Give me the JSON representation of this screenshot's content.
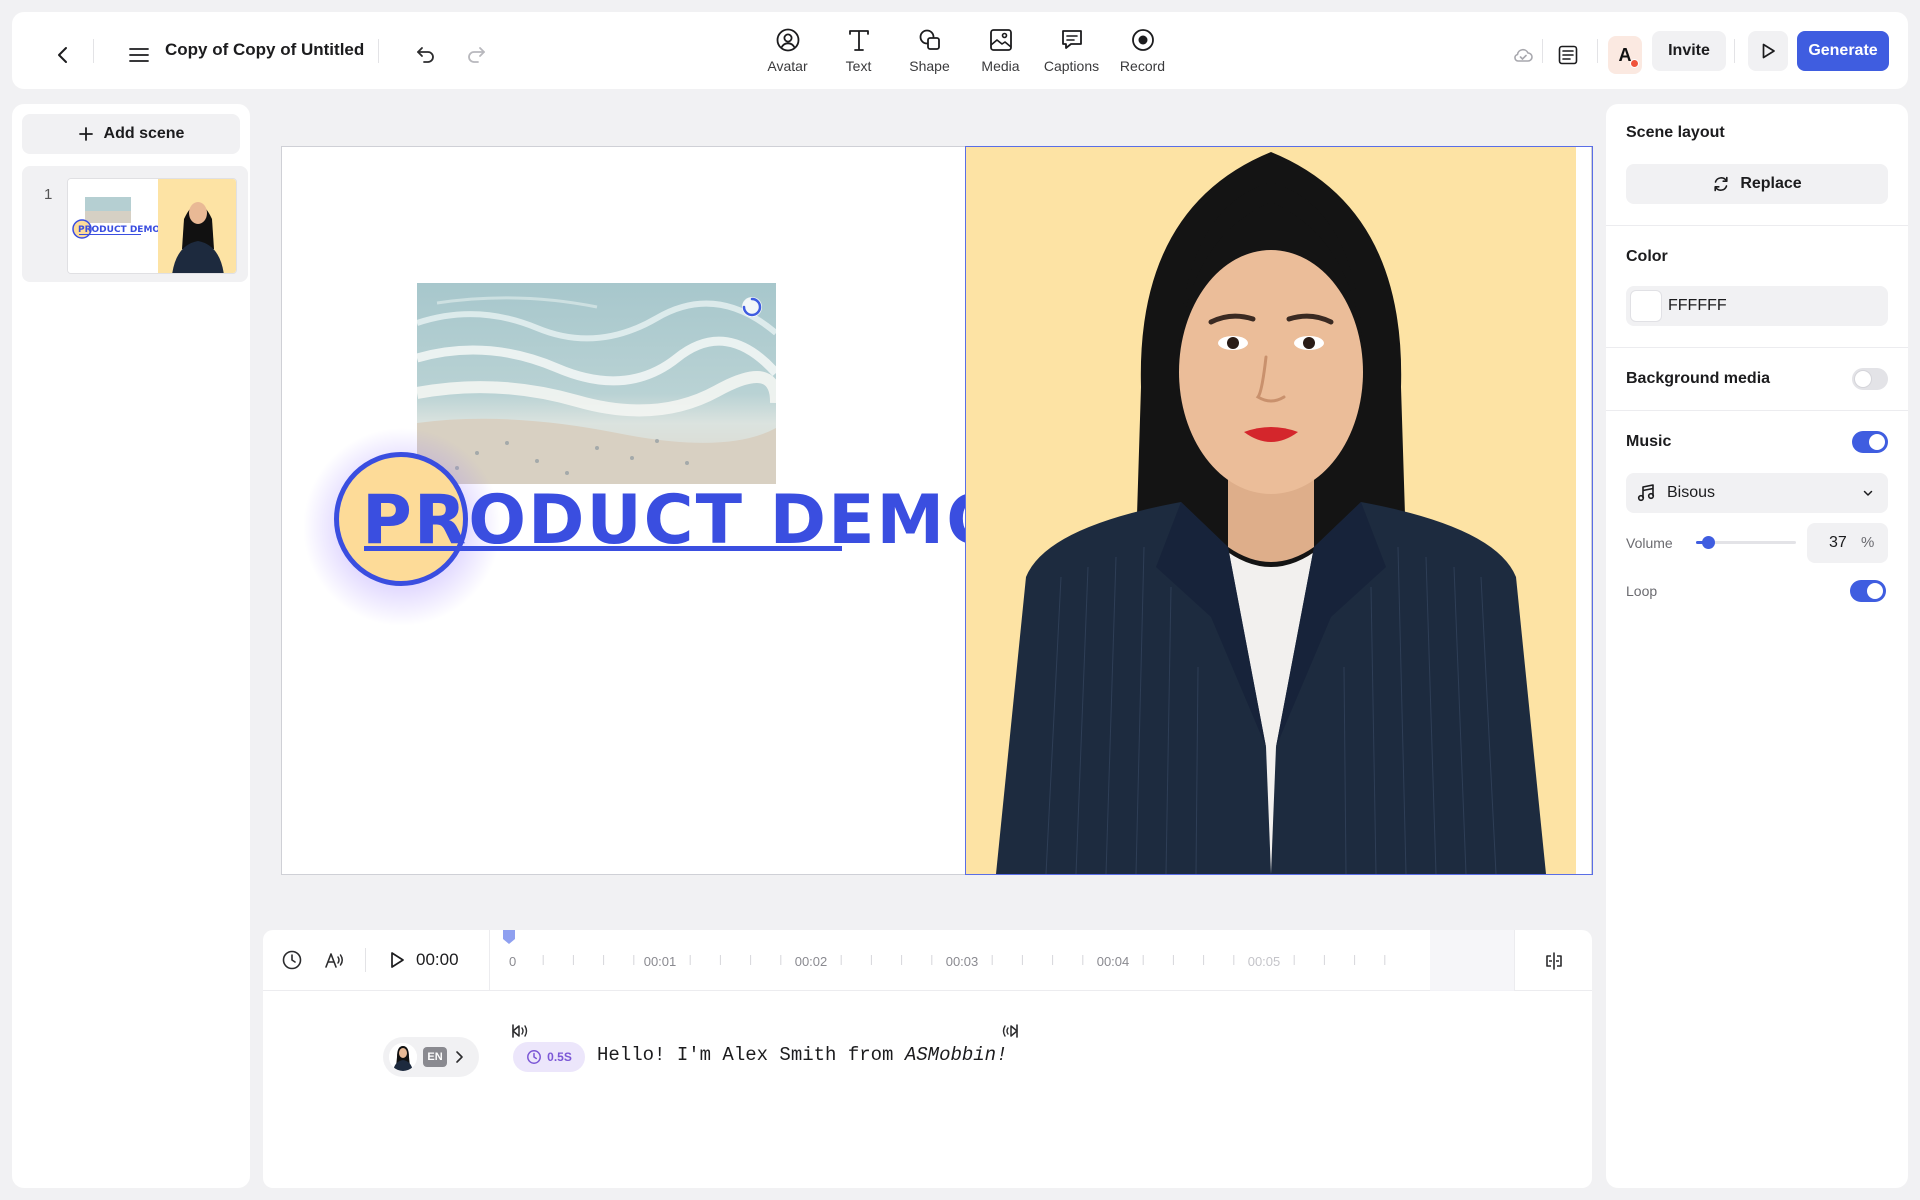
{
  "topbar": {
    "title": "Copy of Copy of Untitled",
    "tools": [
      {
        "label": "Avatar",
        "icon": "avatar-icon"
      },
      {
        "label": "Text",
        "icon": "text-icon"
      },
      {
        "label": "Shape",
        "icon": "shape-icon"
      },
      {
        "label": "Media",
        "icon": "media-icon"
      },
      {
        "label": "Captions",
        "icon": "captions-icon"
      },
      {
        "label": "Record",
        "icon": "record-icon"
      }
    ],
    "user_initial": "A",
    "invite_label": "Invite",
    "generate_label": "Generate"
  },
  "left_panel": {
    "add_scene_label": "Add scene",
    "scenes": [
      {
        "number": "1"
      }
    ]
  },
  "canvas": {
    "title_text": "PRODUCT DEMO",
    "background_color": "#FFFFFF",
    "avatar_bg_color": "#FDE3A4",
    "brand_color": "#3A4EE0"
  },
  "timeline": {
    "time": "00:00",
    "ticks": [
      "0",
      "00:01",
      "00:02",
      "00:03",
      "00:04",
      "00:05"
    ],
    "language": "EN",
    "pause_label": "0.5S",
    "script_plain": "Hello! I'm Alex Smith from ",
    "script_italic": "ASMobbin!"
  },
  "right_panel": {
    "scene_layout_title": "Scene layout",
    "replace_label": "Replace",
    "color_title": "Color",
    "color_value": "FFFFFF",
    "background_media_title": "Background media",
    "background_media_enabled": false,
    "music_title": "Music",
    "music_enabled": true,
    "music_track": "Bisous",
    "volume_label": "Volume",
    "volume_value": "37",
    "volume_unit": "%",
    "volume_fraction": 0.12,
    "loop_label": "Loop",
    "loop_enabled": true
  },
  "help_label": "?",
  "accent_color": "#3F5DE0"
}
